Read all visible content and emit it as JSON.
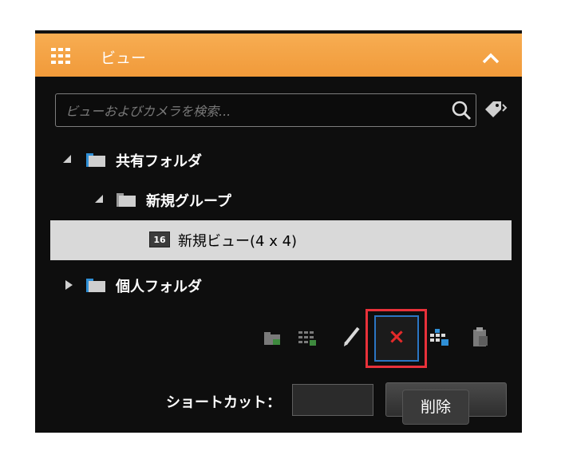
{
  "header": {
    "title": "ビュー",
    "grid_icon": "grid-view-icon",
    "collapse_icon": "chevron-up-icon"
  },
  "search": {
    "placeholder": "ビューおよびカメラを検索...",
    "value": ""
  },
  "tree": {
    "shared_folder": "共有フォルダ",
    "new_group": "新規グループ",
    "new_view_badge": "16",
    "new_view": "新規ビュー(4 x 4)",
    "private_folder": "個人フォルダ"
  },
  "toolbar": {
    "icons": [
      "new-folder-icon",
      "new-view-icon",
      "rename-icon",
      "delete-icon",
      "copy-view-icon",
      "paste-icon"
    ],
    "delete_symbol": "×"
  },
  "shortcut": {
    "label": "ショートカット：",
    "value": ""
  },
  "tooltip": {
    "text": "削除"
  },
  "colors": {
    "header": "#f19a3a",
    "panel": "#0e0e0e",
    "highlight": "#e8313a",
    "folder": "#2f8fd6"
  }
}
